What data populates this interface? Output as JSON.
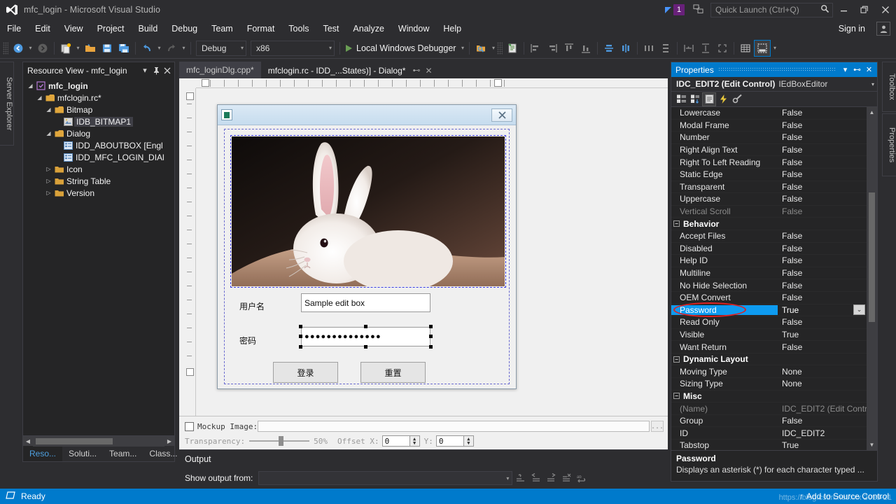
{
  "window": {
    "title": "mfc_login - Microsoft Visual Studio",
    "logo_icon": "visual-studio-logo-icon",
    "minimize_icon": "minimize-icon",
    "restore_icon": "restore-icon",
    "close_icon": "close-icon",
    "notification_count": "1",
    "feedback_icon": "feedback-icon",
    "accent": "#007acc"
  },
  "quick_launch": {
    "placeholder": "Quick Launch (Ctrl+Q)",
    "search_icon": "search-icon"
  },
  "menu": {
    "items": [
      {
        "label": "File"
      },
      {
        "label": "Edit"
      },
      {
        "label": "View"
      },
      {
        "label": "Project"
      },
      {
        "label": "Build"
      },
      {
        "label": "Debug"
      },
      {
        "label": "Team"
      },
      {
        "label": "Format"
      },
      {
        "label": "Tools"
      },
      {
        "label": "Test"
      },
      {
        "label": "Analyze"
      },
      {
        "label": "Window"
      },
      {
        "label": "Help"
      }
    ],
    "sign_in": "Sign in",
    "account_icon": "account-icon"
  },
  "toolbar": {
    "nav_back_icon": "navigate-back-icon",
    "nav_forward_icon": "navigate-forward-icon",
    "new_project_icon": "new-project-icon",
    "open_file_icon": "open-file-icon",
    "save_icon": "save-icon",
    "save_all_icon": "save-all-icon",
    "undo_icon": "undo-icon",
    "redo_icon": "redo-icon",
    "configuration": "Debug",
    "platform": "x86",
    "run_label": "Local Windows Debugger",
    "run_icon": "play-icon",
    "find_icon": "find-in-files-icon",
    "properties_window_icon": "properties-window-icon",
    "align_icons": [
      "align-lefts-icon",
      "align-rights-icon",
      "align-tops-icon",
      "align-bottoms-icon",
      "center-vertical-icon",
      "center-horizontal-icon",
      "space-across-icon",
      "space-down-icon",
      "make-same-width-icon",
      "make-same-height-icon",
      "size-to-content-icon",
      "toggle-grid-icon",
      "test-dialog-icon"
    ]
  },
  "left_strips": [
    {
      "label": "Server Explorer",
      "name": "server-explorer-strip"
    },
    {
      "label": "Toolbox",
      "name": "toolbox-strip"
    },
    {
      "label": "Properties",
      "name": "properties-strip"
    }
  ],
  "resource_view": {
    "title": "Resource View - mfc_login",
    "dropdown_icon": "chevron-down-icon",
    "pin_icon": "pin-icon",
    "close_icon": "close-icon",
    "tree": [
      {
        "label": "mfc_login",
        "depth": 0,
        "arrow": "expanded",
        "icon": "solution-icon",
        "bold": true,
        "selected": false
      },
      {
        "label": "mfclogin.rc*",
        "depth": 1,
        "arrow": "expanded",
        "icon": "rc-file-icon",
        "bold": false,
        "selected": false
      },
      {
        "label": "Bitmap",
        "depth": 2,
        "arrow": "expanded",
        "icon": "folder-open-icon",
        "bold": false,
        "selected": false
      },
      {
        "label": "IDB_BITMAP1",
        "depth": 3,
        "arrow": "none",
        "icon": "bitmap-icon",
        "bold": false,
        "selected": true
      },
      {
        "label": "Dialog",
        "depth": 2,
        "arrow": "expanded",
        "icon": "folder-open-icon",
        "bold": false,
        "selected": false
      },
      {
        "label": "IDD_ABOUTBOX [Engl",
        "depth": 3,
        "arrow": "none",
        "icon": "dialog-icon",
        "bold": false,
        "selected": false
      },
      {
        "label": "IDD_MFC_LOGIN_DIAl",
        "depth": 3,
        "arrow": "none",
        "icon": "dialog-icon",
        "bold": false,
        "selected": false
      },
      {
        "label": "Icon",
        "depth": 2,
        "arrow": "collapsed",
        "icon": "folder-icon",
        "bold": false,
        "selected": false
      },
      {
        "label": "String Table",
        "depth": 2,
        "arrow": "collapsed",
        "icon": "folder-icon",
        "bold": false,
        "selected": false
      },
      {
        "label": "Version",
        "depth": 2,
        "arrow": "collapsed",
        "icon": "folder-icon",
        "bold": false,
        "selected": false
      }
    ],
    "bottom_tabs": [
      {
        "label": "Reso...",
        "selected": true
      },
      {
        "label": "Soluti...",
        "selected": false
      },
      {
        "label": "Team...",
        "selected": false
      },
      {
        "label": "Class...",
        "selected": false
      }
    ]
  },
  "editor_tabs": [
    {
      "label": "mfc_loginDlg.cpp*",
      "active": false
    },
    {
      "label": "mfclogin.rc - IDD_...States)] - Dialog*",
      "active": true,
      "pin_icon": "pin-icon",
      "close_icon": "close-icon"
    }
  ],
  "dialog_designer": {
    "sys_icon": "dialog-system-icon",
    "close_icon": "close-icon",
    "bitmap_name": "rabbit-picture",
    "username_label": "用户名",
    "username_value": "Sample edit box",
    "password_label": "密码",
    "password_value": "●●●●●●●●●●●●●●",
    "login_button": "登录",
    "reset_button": "重置"
  },
  "mockup_bar": {
    "checkbox_label": "Mockup Image:",
    "path_value": "",
    "browse_label": "...",
    "transparency_label": "Transparency:",
    "transparency_value": "50%",
    "offset_label": "Offset X:",
    "offset_x": "0",
    "offset_y_label": "Y:",
    "offset_y": "0"
  },
  "output_panel": {
    "title": "Output",
    "show_output_label": "Show output from:",
    "source_value": "",
    "dropdown_icon": "chevron-down-icon",
    "icons": [
      "find-message-icon",
      "go-to-previous-icon",
      "go-to-next-icon",
      "clear-all-icon",
      "toggle-word-wrap-icon"
    ]
  },
  "properties": {
    "title": "Properties",
    "dropdown_icon": "chevron-down-icon",
    "pin_icon": "pin-icon",
    "close_icon": "close-icon",
    "object_name": "IDC_EDIT2 (Edit Control)",
    "object_editor": "IEdBoxEditor",
    "object_dropdown_icon": "chevron-down-icon",
    "toolbar_icons": [
      "categorized-view-icon",
      "alphabetical-view-icon",
      "properties-icon",
      "events-icon",
      "property-pages-icon"
    ],
    "rows": [
      {
        "name": "Lowercase",
        "value": "False",
        "kind": "prop",
        "dim": false,
        "selected": false
      },
      {
        "name": "Modal Frame",
        "value": "False",
        "kind": "prop",
        "dim": false,
        "selected": false
      },
      {
        "name": "Number",
        "value": "False",
        "kind": "prop",
        "dim": false,
        "selected": false
      },
      {
        "name": "Right Align Text",
        "value": "False",
        "kind": "prop",
        "dim": false,
        "selected": false
      },
      {
        "name": "Right To Left Reading",
        "value": "False",
        "kind": "prop",
        "dim": false,
        "selected": false
      },
      {
        "name": "Static Edge",
        "value": "False",
        "kind": "prop",
        "dim": false,
        "selected": false
      },
      {
        "name": "Transparent",
        "value": "False",
        "kind": "prop",
        "dim": false,
        "selected": false
      },
      {
        "name": "Uppercase",
        "value": "False",
        "kind": "prop",
        "dim": false,
        "selected": false
      },
      {
        "name": "Vertical Scroll",
        "value": "False",
        "kind": "prop",
        "dim": true,
        "selected": false
      },
      {
        "name": "Behavior",
        "value": "",
        "kind": "category"
      },
      {
        "name": "Accept Files",
        "value": "False",
        "kind": "prop",
        "dim": false,
        "selected": false
      },
      {
        "name": "Disabled",
        "value": "False",
        "kind": "prop",
        "dim": false,
        "selected": false
      },
      {
        "name": "Help ID",
        "value": "False",
        "kind": "prop",
        "dim": false,
        "selected": false
      },
      {
        "name": "Multiline",
        "value": "False",
        "kind": "prop",
        "dim": false,
        "selected": false
      },
      {
        "name": "No Hide Selection",
        "value": "False",
        "kind": "prop",
        "dim": false,
        "selected": false
      },
      {
        "name": "OEM Convert",
        "value": "False",
        "kind": "prop",
        "dim": false,
        "selected": false
      },
      {
        "name": "Password",
        "value": "True",
        "kind": "prop",
        "dim": false,
        "selected": true,
        "has_dropdown": true
      },
      {
        "name": "Read Only",
        "value": "False",
        "kind": "prop",
        "dim": false,
        "selected": false
      },
      {
        "name": "Visible",
        "value": "True",
        "kind": "prop",
        "dim": false,
        "selected": false
      },
      {
        "name": "Want Return",
        "value": "False",
        "kind": "prop",
        "dim": false,
        "selected": false
      },
      {
        "name": "Dynamic Layout",
        "value": "",
        "kind": "category"
      },
      {
        "name": "Moving Type",
        "value": "None",
        "kind": "prop",
        "dim": false,
        "selected": false
      },
      {
        "name": "Sizing Type",
        "value": "None",
        "kind": "prop",
        "dim": false,
        "selected": false
      },
      {
        "name": "Misc",
        "value": "",
        "kind": "category"
      },
      {
        "name": "(Name)",
        "value": "IDC_EDIT2 (Edit Contro",
        "kind": "prop",
        "dim": true,
        "selected": false
      },
      {
        "name": "Group",
        "value": "False",
        "kind": "prop",
        "dim": false,
        "selected": false
      },
      {
        "name": "ID",
        "value": "IDC_EDIT2",
        "kind": "prop",
        "dim": false,
        "selected": false
      },
      {
        "name": "Tabstop",
        "value": "True",
        "kind": "prop",
        "dim": false,
        "selected": false
      }
    ],
    "description_title": "Password",
    "description_text": "Displays an asterisk (*) for each character typed ...",
    "annotation_color": "#e02020",
    "selection_color": "#0e9bf0"
  },
  "status_bar": {
    "ready_text": "Ready",
    "ready_icon": "status-icon",
    "source_control_text": "Add to Source Control",
    "source_control_icon": "upload-icon",
    "watermark_text": "https://blog.csdn.net/xxx  2019-21"
  }
}
